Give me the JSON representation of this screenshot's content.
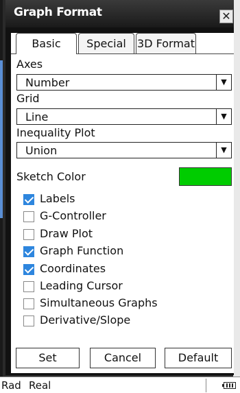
{
  "dialog": {
    "title": "Graph Format",
    "close_glyph": "✕"
  },
  "tabs": [
    {
      "label": "Basic",
      "active": true
    },
    {
      "label": "Special",
      "active": false
    },
    {
      "label": "3D Format",
      "active": false
    }
  ],
  "fields": {
    "axes": {
      "label": "Axes",
      "value": "Number"
    },
    "grid": {
      "label": "Grid",
      "value": "Line"
    },
    "inequality": {
      "label": "Inequality Plot",
      "value": "Union"
    },
    "sketch_color": {
      "label": "Sketch Color",
      "color": "#00cc00"
    }
  },
  "dropdown_arrow": "▼",
  "checkboxes": [
    {
      "label": "Labels",
      "checked": true
    },
    {
      "label": "G-Controller",
      "checked": false
    },
    {
      "label": "Draw Plot",
      "checked": false
    },
    {
      "label": "Graph Function",
      "checked": true
    },
    {
      "label": "Coordinates",
      "checked": true
    },
    {
      "label": "Leading Cursor",
      "checked": false
    },
    {
      "label": "Simultaneous Graphs",
      "checked": false
    },
    {
      "label": "Derivative/Slope",
      "checked": false
    }
  ],
  "buttons": {
    "set": "Set",
    "cancel": "Cancel",
    "default": "Default"
  },
  "status": {
    "angle": "Rad",
    "mode": "Real",
    "battery_icon": "battery-icon"
  },
  "colors": {
    "accent": "#2e86de",
    "sketch": "#00cc00",
    "title_bg": "#1a1a1a"
  }
}
